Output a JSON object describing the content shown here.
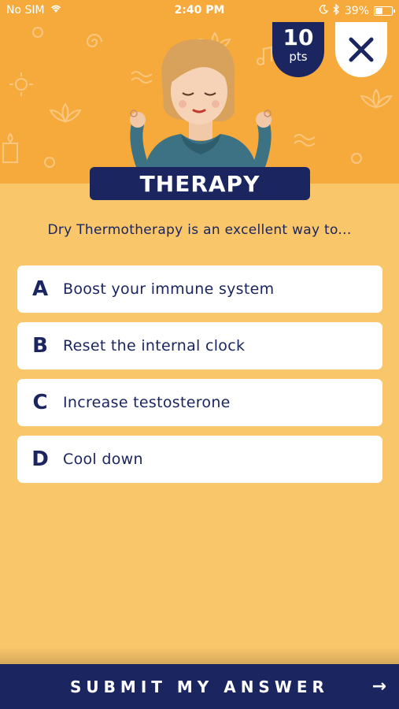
{
  "status_bar": {
    "carrier": "No SIM",
    "time": "2:40 PM",
    "battery_percent": "39%",
    "battery_level": 0.39,
    "icons": [
      "wifi-icon",
      "moon-icon",
      "bluetooth-icon",
      "battery-icon"
    ]
  },
  "header": {
    "points_value": "10",
    "points_unit": "pts",
    "close_icon": "close-icon",
    "category": "THERAPY",
    "illustration": "meditating-woman-illustration"
  },
  "question": {
    "text": "Dry Thermotherapy is an excellent way to..."
  },
  "answers": [
    {
      "letter": "A",
      "text": "Boost your immune system"
    },
    {
      "letter": "B",
      "text": "Reset the internal clock"
    },
    {
      "letter": "C",
      "text": "Increase testosterone"
    },
    {
      "letter": "D",
      "text": "Cool down"
    }
  ],
  "submit": {
    "label": "SUBMIT MY ANSWER",
    "arrow": "→"
  },
  "colors": {
    "background": "#f9c66a",
    "header": "#f6aa3c",
    "navy": "#1b2560",
    "card": "#ffffff"
  }
}
